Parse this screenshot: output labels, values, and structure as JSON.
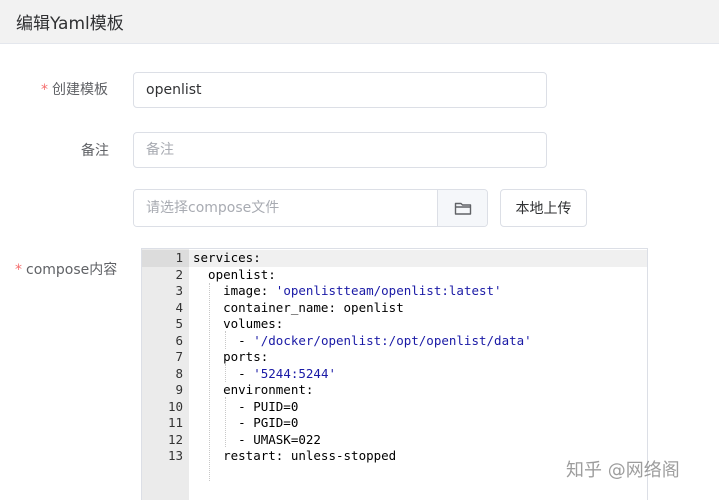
{
  "header": {
    "title": "编辑Yaml模板"
  },
  "form": {
    "template_name": {
      "label": "创建模板",
      "value": "openlist",
      "required": true
    },
    "remark": {
      "label": "备注",
      "placeholder": "备注"
    },
    "compose_file": {
      "placeholder": "请选择compose文件",
      "upload_label": "本地上传"
    },
    "compose_content": {
      "label": "compose内容",
      "required": true
    }
  },
  "editor": {
    "line_numbers": [
      "1",
      "2",
      "3",
      "4",
      "5",
      "6",
      "7",
      "8",
      "9",
      "10",
      "11",
      "12",
      "13"
    ],
    "lines": [
      [
        {
          "t": "services:"
        }
      ],
      [
        {
          "t": "  openlist:"
        }
      ],
      [
        {
          "t": "    image: "
        },
        {
          "t": "'openlistteam/openlist:latest'",
          "s": 1
        }
      ],
      [
        {
          "t": "    container_name: openlist"
        }
      ],
      [
        {
          "t": "    volumes:"
        }
      ],
      [
        {
          "t": "      - "
        },
        {
          "t": "'/docker/openlist:/opt/openlist/data'",
          "s": 1
        }
      ],
      [
        {
          "t": "    ports:"
        }
      ],
      [
        {
          "t": "      - "
        },
        {
          "t": "'5244:5244'",
          "s": 1
        }
      ],
      [
        {
          "t": "    environment:"
        }
      ],
      [
        {
          "t": "      - PUID=0"
        }
      ],
      [
        {
          "t": "      - PGID=0"
        }
      ],
      [
        {
          "t": "      - UMASK=022"
        }
      ],
      [
        {
          "t": "    restart: unless-stopped"
        }
      ]
    ]
  },
  "watermark": {
    "text": "知乎 @网络阁"
  },
  "colors": {
    "required": "#f56c6c",
    "string": "#1a1aa6",
    "gutter": "#ebebeb"
  },
  "icons": {
    "folder": "folder-icon"
  }
}
